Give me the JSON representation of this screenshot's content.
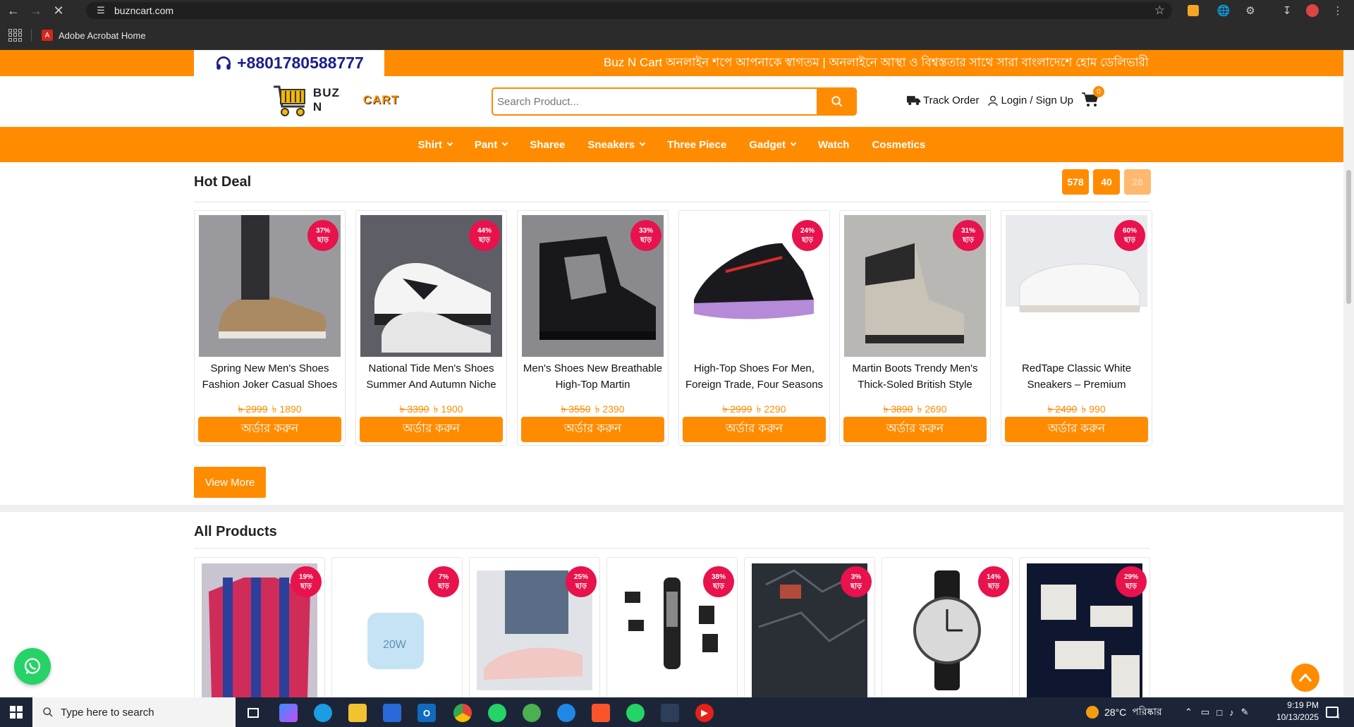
{
  "browser": {
    "url": "buzncart.com",
    "bookmark": "Adobe Acrobat Home"
  },
  "topstrip": {
    "phone": "+8801780588777",
    "marquee": "Buz N Cart অনলাইন শপে আপনাকে স্বাগতম | অনলাইনে আস্থা ও বিশ্বস্ততার সাথে সারা বাংলাদেশে হোম ডেলিভারী দি"
  },
  "header": {
    "logo_buz": "BUZ N",
    "logo_cart": "CART",
    "search_placeholder": "Search Product...",
    "track_order": "Track Order",
    "login": "Login / Sign Up",
    "cart_count": "0"
  },
  "menu": [
    {
      "label": "Shirt",
      "dropdown": true
    },
    {
      "label": "Pant",
      "dropdown": true
    },
    {
      "label": "Sharee",
      "dropdown": false
    },
    {
      "label": "Sneakers",
      "dropdown": true
    },
    {
      "label": "Three Piece",
      "dropdown": false
    },
    {
      "label": "Gadget",
      "dropdown": true
    },
    {
      "label": "Watch",
      "dropdown": false
    },
    {
      "label": "Cosmetics",
      "dropdown": false
    }
  ],
  "hot_deal": {
    "title": "Hot Deal",
    "pager": [
      "578",
      "40",
      "28"
    ],
    "discount_word": "ছাড়",
    "order_label": "অর্ডার করুন",
    "products": [
      {
        "title": "Spring New Men's Shoes Fashion Joker Casual Shoes",
        "old_price": "৳ 2999",
        "new_price": "৳ 1890",
        "discount": "37%"
      },
      {
        "title": "National Tide Men's Shoes Summer And Autumn Niche",
        "old_price": "৳ 3390",
        "new_price": "৳ 1900",
        "discount": "44%"
      },
      {
        "title": "Men's Shoes New Breathable High-Top Martin",
        "old_price": "৳ 3550",
        "new_price": "৳ 2390",
        "discount": "33%"
      },
      {
        "title": "High-Top Shoes For Men, Foreign Trade, Four Seasons",
        "old_price": "৳ 2999",
        "new_price": "৳ 2290",
        "discount": "24%"
      },
      {
        "title": "Martin Boots Trendy Men's Thick-Soled British Style",
        "old_price": "৳ 3890",
        "new_price": "৳ 2690",
        "discount": "31%"
      },
      {
        "title": "RedTape Classic White Sneakers – Premium",
        "old_price": "৳ 2490",
        "new_price": "৳ 990",
        "discount": "60%"
      }
    ],
    "view_more": "View More"
  },
  "all_products": {
    "title": "All Products",
    "discounts": [
      "19%",
      "7%",
      "25%",
      "38%",
      "3%",
      "14%",
      "29%"
    ]
  },
  "taskbar": {
    "search_placeholder": "Type here to search",
    "weather": "28°C",
    "weather_text": "পরিষ্কার",
    "time": "9:19 PM",
    "date": "10/13/2025",
    "notif": "4"
  },
  "colors": {
    "accent": "#ff8c00",
    "badge": "#e8124c",
    "phone_text": "#1a1f8c"
  }
}
